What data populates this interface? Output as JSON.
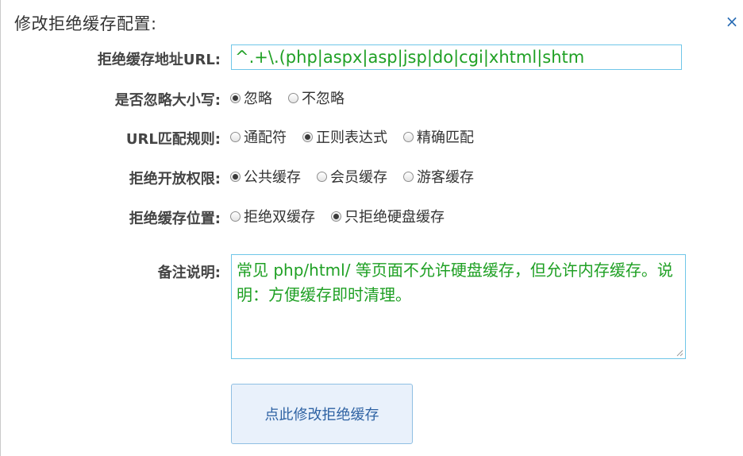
{
  "dialog": {
    "title": "修改拒绝缓存配置:",
    "close_glyph": "×"
  },
  "form": {
    "url": {
      "label": "拒绝缓存地址URL:",
      "value": "^.+\\.(php|aspx|asp|jsp|do|cgi|xhtml|shtm"
    },
    "ignore_case": {
      "label": "是否忽略大小写:",
      "options": [
        {
          "label": "忽略",
          "checked": true
        },
        {
          "label": "不忽略",
          "checked": false
        }
      ]
    },
    "url_match_rule": {
      "label": "URL匹配规则:",
      "options": [
        {
          "label": "通配符",
          "checked": false
        },
        {
          "label": "正则表达式",
          "checked": true
        },
        {
          "label": "精确匹配",
          "checked": false
        }
      ]
    },
    "deny_scope": {
      "label": "拒绝开放权限:",
      "options": [
        {
          "label": "公共缓存",
          "checked": true
        },
        {
          "label": "会员缓存",
          "checked": false
        },
        {
          "label": "游客缓存",
          "checked": false
        }
      ]
    },
    "deny_location": {
      "label": "拒绝缓存位置:",
      "options": [
        {
          "label": "拒绝双缓存",
          "checked": false
        },
        {
          "label": "只拒绝硬盘缓存",
          "checked": true
        }
      ]
    },
    "remark": {
      "label": "备注说明:",
      "value": "常见 php/html/ 等页面不允许硬盘缓存，但允许内存缓存。说明：方便缓存即时清理。"
    },
    "submit_label": "点此修改拒绝缓存"
  },
  "colors": {
    "input_text": "#1fa024",
    "input_border": "#6fc6e8",
    "button_bg": "#e9f1fb",
    "button_text": "#2e62a3",
    "close_icon": "#2a6db5"
  }
}
